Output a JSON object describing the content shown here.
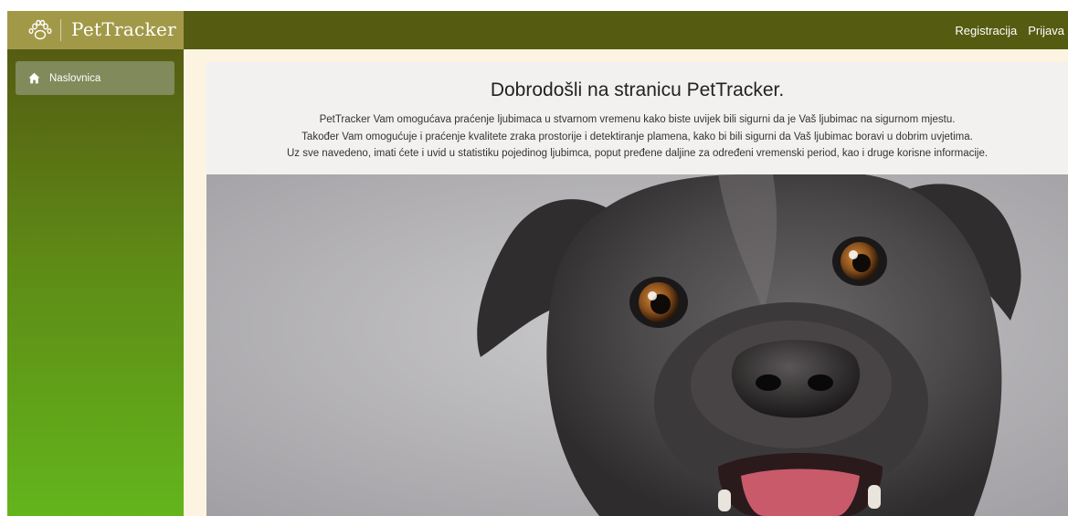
{
  "app": {
    "brand": "PetTracker",
    "brand_icon": "paw-icon"
  },
  "header": {
    "links": [
      {
        "label": "Registracija"
      },
      {
        "label": "Prijava"
      }
    ]
  },
  "sidebar": {
    "items": [
      {
        "label": "Naslovnica",
        "icon": "home-icon",
        "active": true
      }
    ]
  },
  "main": {
    "title": "Dobrodošli na stranicu PetTracker.",
    "paragraphs": [
      "PetTracker Vam omogućava praćenje ljubimaca u stvarnom vremenu kako biste uvijek bili sigurni da je Vaš ljubimac na sigurnom mjestu.",
      "Također Vam omogućuje i praćenje kvalitete zraka prostorije i detektiranje plamena, kako bi bili sigurni da Vaš ljubimac boravi u dobrim uvjetima.",
      "Uz sve navedeno, imati ćete i uvid u statistiku pojedinog ljubimca, poput pređene daljine za određeni vremenski period, kao i druge korisne informacije."
    ],
    "hero_image": "dog-photo"
  },
  "colors": {
    "header": "#555c12",
    "brand_bg": "#a29948",
    "sidebar_top": "#555c12",
    "sidebar_bottom": "#63b51c",
    "active_item": "#818a5a",
    "page_bg": "#fdf3e1"
  }
}
